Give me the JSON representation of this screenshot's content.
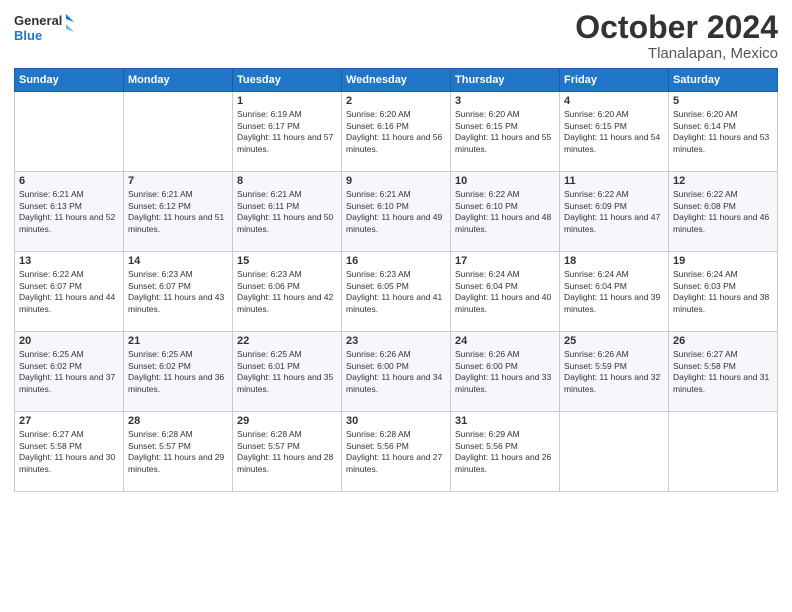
{
  "logo": {
    "line1": "General",
    "line2": "Blue"
  },
  "title": {
    "month": "October 2024",
    "location": "Tlanalapan, Mexico"
  },
  "weekdays": [
    "Sunday",
    "Monday",
    "Tuesday",
    "Wednesday",
    "Thursday",
    "Friday",
    "Saturday"
  ],
  "weeks": [
    [
      {
        "day": "",
        "sunrise": "",
        "sunset": "",
        "daylight": ""
      },
      {
        "day": "",
        "sunrise": "",
        "sunset": "",
        "daylight": ""
      },
      {
        "day": "1",
        "sunrise": "Sunrise: 6:19 AM",
        "sunset": "Sunset: 6:17 PM",
        "daylight": "Daylight: 11 hours and 57 minutes."
      },
      {
        "day": "2",
        "sunrise": "Sunrise: 6:20 AM",
        "sunset": "Sunset: 6:16 PM",
        "daylight": "Daylight: 11 hours and 56 minutes."
      },
      {
        "day": "3",
        "sunrise": "Sunrise: 6:20 AM",
        "sunset": "Sunset: 6:15 PM",
        "daylight": "Daylight: 11 hours and 55 minutes."
      },
      {
        "day": "4",
        "sunrise": "Sunrise: 6:20 AM",
        "sunset": "Sunset: 6:15 PM",
        "daylight": "Daylight: 11 hours and 54 minutes."
      },
      {
        "day": "5",
        "sunrise": "Sunrise: 6:20 AM",
        "sunset": "Sunset: 6:14 PM",
        "daylight": "Daylight: 11 hours and 53 minutes."
      }
    ],
    [
      {
        "day": "6",
        "sunrise": "Sunrise: 6:21 AM",
        "sunset": "Sunset: 6:13 PM",
        "daylight": "Daylight: 11 hours and 52 minutes."
      },
      {
        "day": "7",
        "sunrise": "Sunrise: 6:21 AM",
        "sunset": "Sunset: 6:12 PM",
        "daylight": "Daylight: 11 hours and 51 minutes."
      },
      {
        "day": "8",
        "sunrise": "Sunrise: 6:21 AM",
        "sunset": "Sunset: 6:11 PM",
        "daylight": "Daylight: 11 hours and 50 minutes."
      },
      {
        "day": "9",
        "sunrise": "Sunrise: 6:21 AM",
        "sunset": "Sunset: 6:10 PM",
        "daylight": "Daylight: 11 hours and 49 minutes."
      },
      {
        "day": "10",
        "sunrise": "Sunrise: 6:22 AM",
        "sunset": "Sunset: 6:10 PM",
        "daylight": "Daylight: 11 hours and 48 minutes."
      },
      {
        "day": "11",
        "sunrise": "Sunrise: 6:22 AM",
        "sunset": "Sunset: 6:09 PM",
        "daylight": "Daylight: 11 hours and 47 minutes."
      },
      {
        "day": "12",
        "sunrise": "Sunrise: 6:22 AM",
        "sunset": "Sunset: 6:08 PM",
        "daylight": "Daylight: 11 hours and 46 minutes."
      }
    ],
    [
      {
        "day": "13",
        "sunrise": "Sunrise: 6:22 AM",
        "sunset": "Sunset: 6:07 PM",
        "daylight": "Daylight: 11 hours and 44 minutes."
      },
      {
        "day": "14",
        "sunrise": "Sunrise: 6:23 AM",
        "sunset": "Sunset: 6:07 PM",
        "daylight": "Daylight: 11 hours and 43 minutes."
      },
      {
        "day": "15",
        "sunrise": "Sunrise: 6:23 AM",
        "sunset": "Sunset: 6:06 PM",
        "daylight": "Daylight: 11 hours and 42 minutes."
      },
      {
        "day": "16",
        "sunrise": "Sunrise: 6:23 AM",
        "sunset": "Sunset: 6:05 PM",
        "daylight": "Daylight: 11 hours and 41 minutes."
      },
      {
        "day": "17",
        "sunrise": "Sunrise: 6:24 AM",
        "sunset": "Sunset: 6:04 PM",
        "daylight": "Daylight: 11 hours and 40 minutes."
      },
      {
        "day": "18",
        "sunrise": "Sunrise: 6:24 AM",
        "sunset": "Sunset: 6:04 PM",
        "daylight": "Daylight: 11 hours and 39 minutes."
      },
      {
        "day": "19",
        "sunrise": "Sunrise: 6:24 AM",
        "sunset": "Sunset: 6:03 PM",
        "daylight": "Daylight: 11 hours and 38 minutes."
      }
    ],
    [
      {
        "day": "20",
        "sunrise": "Sunrise: 6:25 AM",
        "sunset": "Sunset: 6:02 PM",
        "daylight": "Daylight: 11 hours and 37 minutes."
      },
      {
        "day": "21",
        "sunrise": "Sunrise: 6:25 AM",
        "sunset": "Sunset: 6:02 PM",
        "daylight": "Daylight: 11 hours and 36 minutes."
      },
      {
        "day": "22",
        "sunrise": "Sunrise: 6:25 AM",
        "sunset": "Sunset: 6:01 PM",
        "daylight": "Daylight: 11 hours and 35 minutes."
      },
      {
        "day": "23",
        "sunrise": "Sunrise: 6:26 AM",
        "sunset": "Sunset: 6:00 PM",
        "daylight": "Daylight: 11 hours and 34 minutes."
      },
      {
        "day": "24",
        "sunrise": "Sunrise: 6:26 AM",
        "sunset": "Sunset: 6:00 PM",
        "daylight": "Daylight: 11 hours and 33 minutes."
      },
      {
        "day": "25",
        "sunrise": "Sunrise: 6:26 AM",
        "sunset": "Sunset: 5:59 PM",
        "daylight": "Daylight: 11 hours and 32 minutes."
      },
      {
        "day": "26",
        "sunrise": "Sunrise: 6:27 AM",
        "sunset": "Sunset: 5:58 PM",
        "daylight": "Daylight: 11 hours and 31 minutes."
      }
    ],
    [
      {
        "day": "27",
        "sunrise": "Sunrise: 6:27 AM",
        "sunset": "Sunset: 5:58 PM",
        "daylight": "Daylight: 11 hours and 30 minutes."
      },
      {
        "day": "28",
        "sunrise": "Sunrise: 6:28 AM",
        "sunset": "Sunset: 5:57 PM",
        "daylight": "Daylight: 11 hours and 29 minutes."
      },
      {
        "day": "29",
        "sunrise": "Sunrise: 6:28 AM",
        "sunset": "Sunset: 5:57 PM",
        "daylight": "Daylight: 11 hours and 28 minutes."
      },
      {
        "day": "30",
        "sunrise": "Sunrise: 6:28 AM",
        "sunset": "Sunset: 5:56 PM",
        "daylight": "Daylight: 11 hours and 27 minutes."
      },
      {
        "day": "31",
        "sunrise": "Sunrise: 6:29 AM",
        "sunset": "Sunset: 5:56 PM",
        "daylight": "Daylight: 11 hours and 26 minutes."
      },
      {
        "day": "",
        "sunrise": "",
        "sunset": "",
        "daylight": ""
      },
      {
        "day": "",
        "sunrise": "",
        "sunset": "",
        "daylight": ""
      }
    ]
  ]
}
